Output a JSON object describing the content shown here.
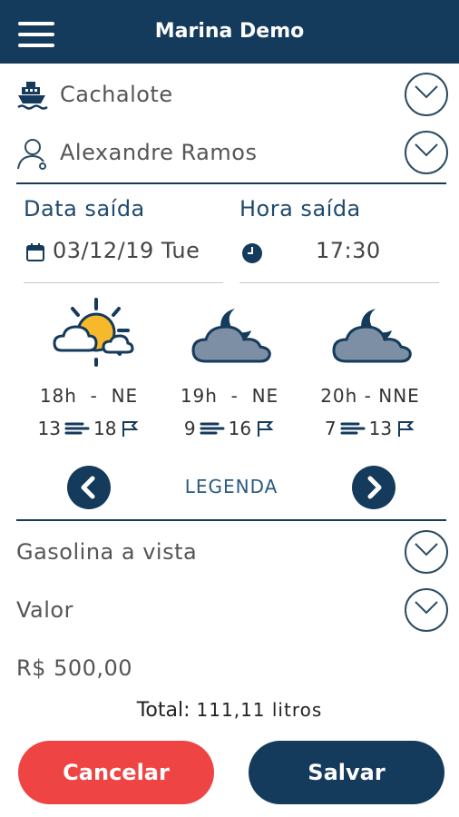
{
  "header": {
    "title": "Marina Demo",
    "menu_icon": "hamburger-icon"
  },
  "vessel": {
    "name": "Cachalote",
    "icon": "boat-icon"
  },
  "person": {
    "name": "Alexandre Ramos",
    "icon": "user-icon"
  },
  "departure": {
    "date_label": "Data saída",
    "date_value": "03/12/19 Tue",
    "time_label": "Hora saída",
    "time_value": "17:30"
  },
  "weather": [
    {
      "time": "18h  -  NE",
      "wind": "13",
      "gust": "18",
      "icon": "sun-cloud-icon"
    },
    {
      "time": "19h  -  NE",
      "wind": "9",
      "gust": "16",
      "icon": "moon-cloud-icon"
    },
    {
      "time": "20h - NNE",
      "wind": "7",
      "gust": "13",
      "icon": "moon-cloud-icon"
    }
  ],
  "legend_label": "LEGENDA",
  "fuel": {
    "type": "Gasolina a vista",
    "value_label": "Valor",
    "amount": "R$ 500,00"
  },
  "total": {
    "label": "Total:",
    "value": "111,11 litros"
  },
  "buttons": {
    "cancel": "Cancelar",
    "save": "Salvar"
  },
  "colors": {
    "primary": "#143a5c",
    "danger": "#ee4444"
  }
}
